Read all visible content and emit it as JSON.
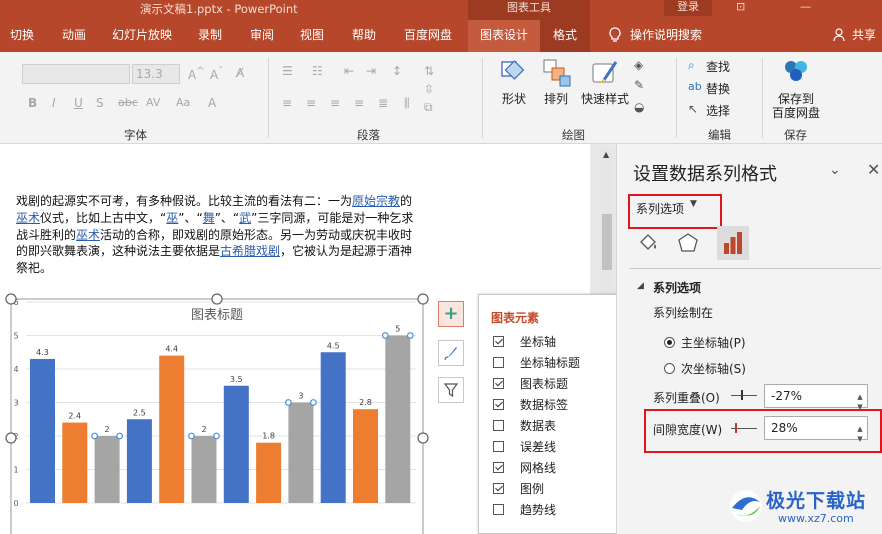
{
  "window": {
    "title": "演示文稿1.pptx  -  PowerPoint",
    "context_group": "图表工具",
    "login": "登录"
  },
  "tabs": [
    {
      "label": "切换"
    },
    {
      "label": "动画"
    },
    {
      "label": "幻灯片放映"
    },
    {
      "label": "录制"
    },
    {
      "label": "审阅"
    },
    {
      "label": "视图"
    },
    {
      "label": "帮助"
    },
    {
      "label": "百度网盘"
    },
    {
      "label": "图表设计"
    },
    {
      "label": "格式"
    }
  ],
  "tell_me": "操作说明搜索",
  "share": "共享",
  "ribbon": {
    "font_size": "13.3",
    "groups": {
      "font": "字体",
      "paragraph": "段落",
      "drawing": "绘图",
      "editing": "编辑",
      "save": "保存"
    },
    "buttons": {
      "shape": "形状",
      "arrange": "排列",
      "quick_style": "快速样式",
      "find": "查找",
      "replace": "替换",
      "select": "选择",
      "save_baidu_1": "保存到",
      "save_baidu_2": "百度网盘"
    }
  },
  "body_text": {
    "p1_a": "戏剧的起源实不可考，有多种假说。比较主流的看法有二：一为",
    "link1": "原始宗教",
    "p1_b": "的",
    "link2": "巫术",
    "p1_c": "仪式，比如上古中文，“",
    "link3": "巫",
    "p1_d": "”、“",
    "link4": "舞",
    "p1_e": "”、“",
    "link5": "武",
    "p1_f": "”三字同源，可能是对一种乞求战斗胜利的",
    "link6": "巫术",
    "p1_g": "活动的合称，即戏剧的原始形态。另一为劳动或庆祝丰收时的即兴歌舞表演，这种说法主要依据是",
    "link7": "古希腊戏剧",
    "p1_h": "，它被认为是起源于酒神祭祀。"
  },
  "chart_data": {
    "type": "bar",
    "title": "图表标题",
    "categories": [
      "",
      "",
      "",
      ""
    ],
    "ylim": [
      0,
      6
    ],
    "yticks": [
      "0",
      "1",
      "2",
      "3",
      "4",
      "5",
      "6"
    ],
    "series": [
      {
        "color": "#4472c4",
        "values": [
          4.3,
          2.5,
          3.5,
          4.5
        ]
      },
      {
        "color": "#ed7d31",
        "values": [
          2.4,
          4.4,
          1.8,
          2.8
        ]
      },
      {
        "color": "#a5a5a5",
        "values": [
          2,
          2,
          3,
          5
        ],
        "selected": true
      }
    ],
    "data_labels": true,
    "grid": true
  },
  "chart_elements": {
    "title": "图表元素",
    "items": [
      {
        "label": "坐标轴",
        "checked": true
      },
      {
        "label": "坐标轴标题",
        "checked": false
      },
      {
        "label": "图表标题",
        "checked": true
      },
      {
        "label": "数据标签",
        "checked": true
      },
      {
        "label": "数据表",
        "checked": false
      },
      {
        "label": "误差线",
        "checked": false
      },
      {
        "label": "网格线",
        "checked": true
      },
      {
        "label": "图例",
        "checked": true
      },
      {
        "label": "趋势线",
        "checked": false
      }
    ]
  },
  "pane": {
    "title": "设置数据系列格式",
    "options_dropdown": "系列选项",
    "section": "系列选项",
    "plot_on": "系列绘制在",
    "primary_axis": "主坐标轴(P)",
    "secondary_axis": "次坐标轴(S)",
    "overlap_label": "系列重叠(O)",
    "overlap_value": "-27%",
    "gap_label": "间隙宽度(W)",
    "gap_value": "28%",
    "axis_selected": "primary"
  },
  "watermark": {
    "text": "极光下载站",
    "url": "www.xz7.com"
  }
}
